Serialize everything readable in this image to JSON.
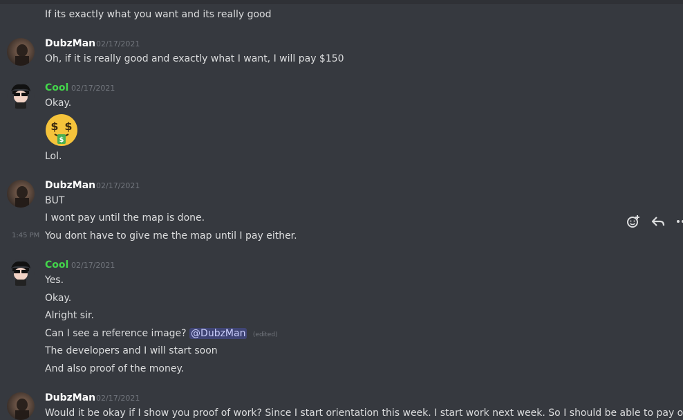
{
  "messages": {
    "m0_text": "If its exactly what you want and its really good",
    "g1_author": "DubzMan",
    "g1_ts": "02/17/2021",
    "g1_l1": "Oh, if it is really good and exactly what I want, I will pay $150",
    "g2_author": "Cool",
    "g2_ts": "02/17/2021",
    "g2_l1": "Okay.",
    "g2_l2": "Lol.",
    "g3_author": "DubzMan",
    "g3_ts": "02/17/2021",
    "g3_l1": "BUT",
    "g3_l2": "I wont pay until the map is done.",
    "g3_hover_ts": "1:45 PM",
    "g3_l3": "You dont have to give me the map until I pay either.",
    "g4_author": "Cool",
    "g4_ts": "02/17/2021",
    "g4_l1": "Yes.",
    "g4_l2": "Okay.",
    "g4_l3": "Alright sir.",
    "g4_l4_prefix": "Can I see a reference image?",
    "g4_l4_mention": "@DubzMan",
    "g4_l4_edited": "(edited)",
    "g4_l5": "The developers and I will start soon",
    "g4_l6": "And also proof of the money.",
    "g5_author": "DubzMan",
    "g5_ts": "02/17/2021",
    "g5_l1": "Would it be okay if I show you proof of work? Since I start orientation this week. I start work next week. So I should be able to pay once"
  },
  "icons": {
    "add_reaction": "add-reaction-icon",
    "reply": "reply-icon",
    "more": "more-icon",
    "money_mouth": "money-mouth-face-emoji"
  },
  "colors": {
    "background": "#36393f",
    "text": "#dcddde",
    "cool_name": "#43d64b",
    "mention_bg": "#5865f2",
    "muted": "#72767d"
  }
}
